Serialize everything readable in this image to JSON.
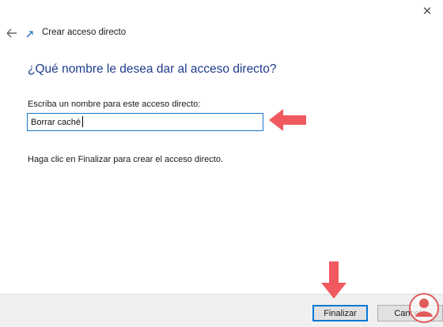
{
  "titlebar": {
    "close_glyph": "✕"
  },
  "header": {
    "title": "Crear acceso directo"
  },
  "main": {
    "heading": "¿Qué nombre le desea dar al acceso directo?",
    "field_label": "Escriba un nombre para este acceso directo:",
    "field_value": "Borrar caché",
    "hint": "Haga clic en Finalizar para crear el acceso directo."
  },
  "footer": {
    "finish_label": "Finalizar",
    "cancel_label": "Cancela"
  },
  "colors": {
    "heading": "#1f3c8c",
    "accent": "#0078d7",
    "annotation_arrow": "#f05a5e"
  }
}
